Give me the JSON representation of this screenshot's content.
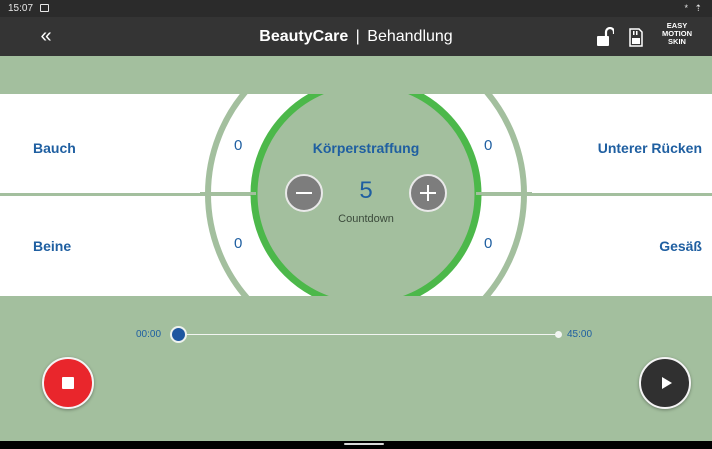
{
  "status_bar": {
    "time": "15:07",
    "system_icons": "* ⇡"
  },
  "app_bar": {
    "back_icon": "double-chevron-left-icon",
    "back_glyph": "«",
    "brand": "BeautyCare",
    "separator": "|",
    "screen": "Behandlung",
    "logo_line1": "EASY",
    "logo_line2": "MOTION",
    "logo_line3": "SKIN"
  },
  "zones": {
    "top_left": {
      "name": "Bauch",
      "value": "0"
    },
    "top_right": {
      "name": "Unterer Rücken",
      "value": "0"
    },
    "bottom_left": {
      "name": "Beine",
      "value": "0"
    },
    "bottom_right": {
      "name": "Gesäß",
      "value": "0"
    }
  },
  "program": {
    "name": "Körperstraffung",
    "countdown_value": "5",
    "countdown_label": "Countdown"
  },
  "progress": {
    "start_time": "00:00",
    "end_time": "45:00",
    "fraction": 0.0
  },
  "colors": {
    "accent_green": "#4cb84a",
    "panel_green": "#a3bf9e",
    "text_blue": "#1f5fa1",
    "stop_red": "#e9262c",
    "app_bar": "#343434"
  }
}
